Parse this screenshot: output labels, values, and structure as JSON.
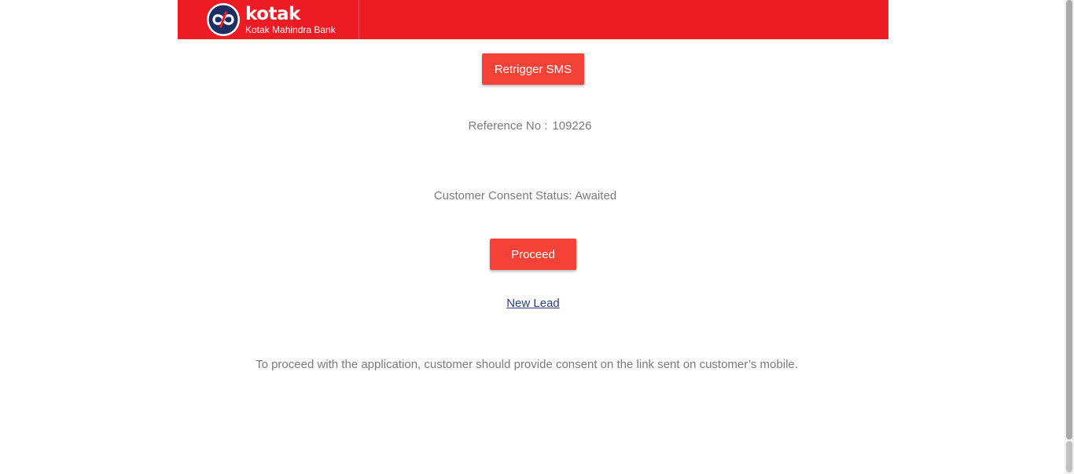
{
  "header": {
    "brand_name": "kotak",
    "brand_subtitle": "Kotak Mahindra Bank",
    "background_color": "#ed1c24"
  },
  "actions": {
    "retrigger_label": "Retrigger SMS",
    "proceed_label": "Proceed",
    "new_lead_label": "New Lead",
    "button_color": "#f44336"
  },
  "reference": {
    "label": "Reference No :",
    "value": "109226"
  },
  "consent": {
    "status_text": "Customer Consent Status: Awaited"
  },
  "note": {
    "text": "To proceed with the application, customer should provide consent on the link sent on customer’s mobile."
  },
  "icons": {
    "logo": "kotak-infinity-logo-icon"
  }
}
